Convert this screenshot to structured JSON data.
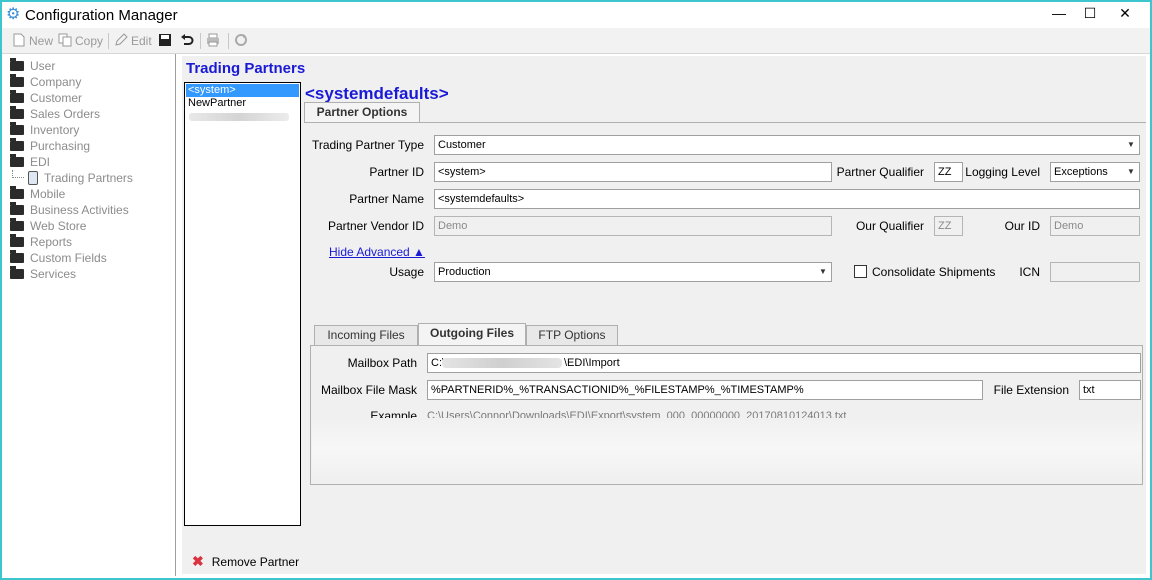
{
  "window": {
    "title": "Configuration Manager",
    "min": "—",
    "max": "☐",
    "close": "✕"
  },
  "toolbar": {
    "new": "New",
    "copy": "Copy",
    "edit": "Edit"
  },
  "nav": {
    "items": [
      "User",
      "Company",
      "Customer",
      "Sales Orders",
      "Inventory",
      "Purchasing",
      "EDI",
      "Mobile",
      "Business Activities",
      "Web Store",
      "Reports",
      "Custom Fields",
      "Services"
    ],
    "subitem": "Trading Partners"
  },
  "section_title": "Trading Partners",
  "partners": {
    "items": [
      "<system>",
      "NewPartner"
    ],
    "selected": 0,
    "remove": "Remove Partner"
  },
  "detail": {
    "heading": "<systemdefaults>",
    "tab_label": "Partner Options",
    "trading_partner_type_label": "Trading Partner Type",
    "trading_partner_type": "Customer",
    "partner_id_label": "Partner ID",
    "partner_id": "<system>",
    "partner_qualifier_label": "Partner Qualifier",
    "partner_qualifier": "ZZ",
    "logging_level_label": "Logging Level",
    "logging_level": "Exceptions",
    "partner_name_label": "Partner Name",
    "partner_name": "<systemdefaults>",
    "partner_vendor_id_label": "Partner Vendor ID",
    "partner_vendor_id": "Demo",
    "our_qualifier_label": "Our Qualifier",
    "our_qualifier": "ZZ",
    "our_id_label": "Our ID",
    "our_id": "Demo",
    "hide_advanced": "Hide Advanced ▲",
    "usage_label": "Usage",
    "usage": "Production",
    "consolidate_label": "Consolidate Shipments",
    "icn_label": "ICN",
    "icn": ""
  },
  "subtabs": [
    "Incoming Files",
    "Outgoing Files",
    "FTP Options"
  ],
  "outgoing": {
    "mailbox_path_label": "Mailbox Path",
    "mailbox_path_start": "C:\\",
    "mailbox_path_end": "\\EDI\\Import",
    "mailbox_mask_label": "Mailbox File Mask",
    "mailbox_mask": "%PARTNERID%_%TRANSACTIONID%_%FILESTAMP%_%TIMESTAMP%",
    "file_ext_label": "File Extension",
    "file_ext": "txt",
    "example_label": "Example",
    "example": "C:\\Users\\Connor\\Downloads\\EDI\\Export\\system_000_00000000_20170810124013.txt"
  }
}
